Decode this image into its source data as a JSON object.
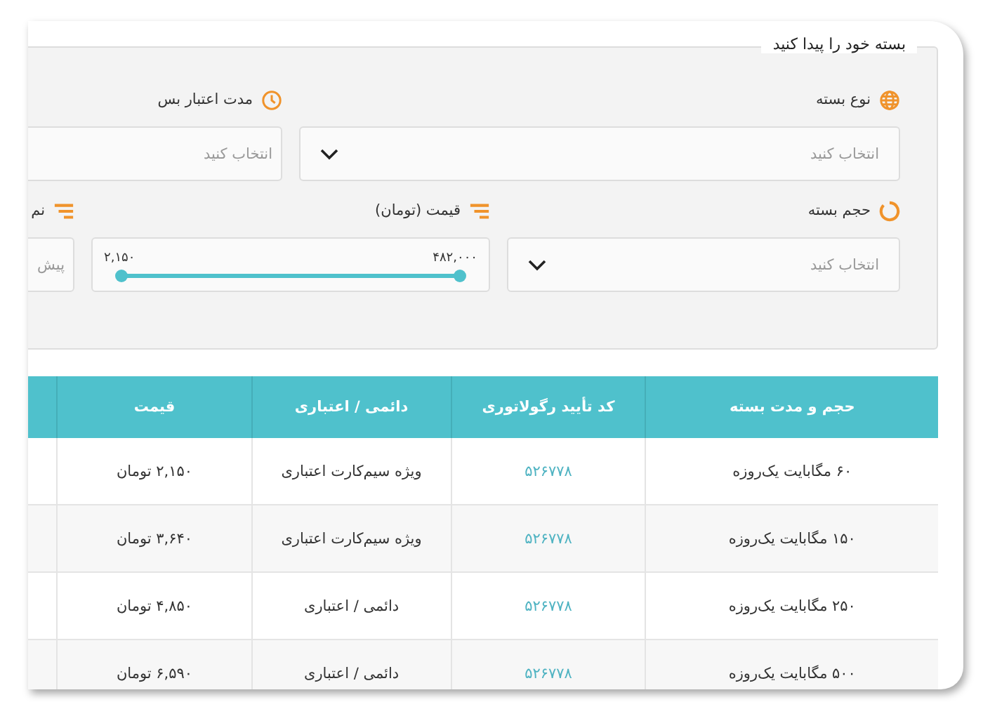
{
  "search_panel": {
    "title": "بسته خود را پیدا کنید",
    "rows": [
      [
        {
          "kind": "select",
          "label": "نوع بسته",
          "placeholder": "انتخاب کنید"
        },
        {
          "kind": "field",
          "label": "مدت اعتبار بس",
          "placeholder": "انتخاب کنید"
        }
      ],
      [
        {
          "kind": "select",
          "label": "حجم بسته",
          "placeholder": "انتخاب کنید"
        },
        {
          "kind": "range",
          "label": "قیمت (تومان)",
          "max_label": "۴۸۲,۰۰۰",
          "min_label": "۲,۱۵۰",
          "level": 1
        },
        {
          "kind": "field",
          "label": "نم",
          "placeholder": "پیش"
        }
      ]
    ]
  },
  "table": {
    "columns": [
      "حجم و مدت بسته",
      "کد تأیید رگولاتوری",
      "دائمی / اعتباری",
      "قیمت"
    ],
    "rows": [
      [
        "۶۰ مگابایت یک‌روزه",
        "۵۲۶۷۷۸",
        "ویژه سیم‌کارت اعتباری",
        "۲,۱۵۰ تومان"
      ],
      [
        "۱۵۰ مگابایت یک‌روزه",
        "۵۲۶۷۷۸",
        "ویژه سیم‌کارت اعتباری",
        "۳,۶۴۰ تومان"
      ],
      [
        "۲۵۰ مگابایت یک‌روزه",
        "۵۲۶۷۷۸",
        "دائمی / اعتباری",
        "۴,۸۵۰ تومان"
      ],
      [
        "۵۰۰ مگابایت یک‌روزه",
        "۵۲۶۷۷۸",
        "دائمی / اعتباری",
        "۶,۵۹۰ تومان"
      ]
    ]
  }
}
